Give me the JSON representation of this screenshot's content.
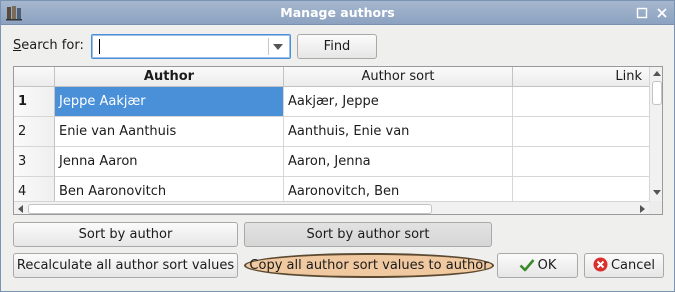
{
  "window": {
    "title": "Manage authors"
  },
  "search": {
    "label_prefix": "",
    "label_mnemonic": "S",
    "label_rest": "earch for:",
    "value": "",
    "find_label": "Find"
  },
  "table": {
    "columns": [
      "Author",
      "Author sort",
      "Link"
    ],
    "rows": [
      {
        "num": "1",
        "author": "Jeppe Aakjær",
        "sort": "Aakjær, Jeppe",
        "link": ""
      },
      {
        "num": "2",
        "author": "Enie van Aanthuis",
        "sort": "Aanthuis, Enie van",
        "link": ""
      },
      {
        "num": "3",
        "author": "Jenna Aaron",
        "sort": "Aaron, Jenna",
        "link": ""
      },
      {
        "num": "4",
        "author": "Ben Aaronovitch",
        "sort": "Aaronovitch, Ben",
        "link": ""
      }
    ]
  },
  "buttons": {
    "sort_by_author": "Sort by author",
    "sort_by_author_sort": "Sort by author sort",
    "recalculate": "Recalculate all author sort values",
    "copy": "Copy all author sort values to author",
    "ok": "OK",
    "cancel": "Cancel"
  },
  "colors": {
    "selection": "#4a90d9",
    "highlight": "#f1c9a0",
    "titlebar": "#97abc7"
  },
  "icons": {
    "app": "books-icon",
    "maximize": "maximize-icon",
    "close": "close-icon",
    "ok": "checkmark-icon",
    "cancel": "cancel-icon"
  }
}
